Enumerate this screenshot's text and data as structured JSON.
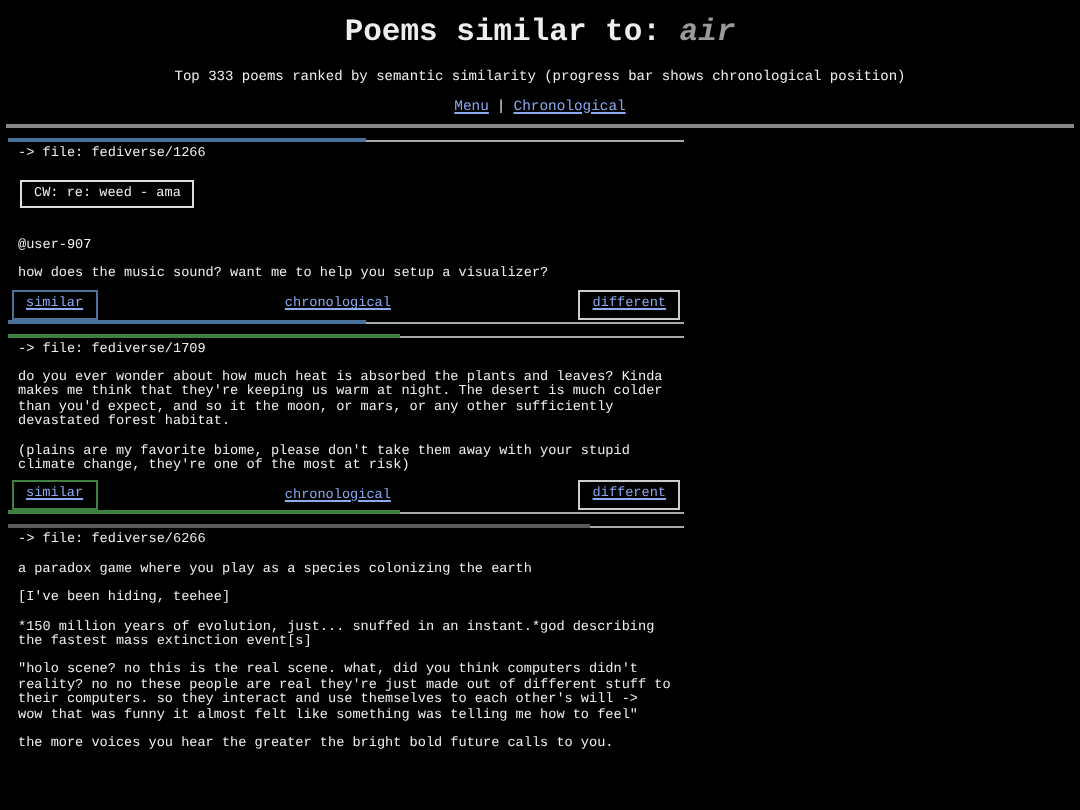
{
  "header": {
    "title": "Poems similar to:",
    "query": "air",
    "subtitle": "Top 333 poems ranked by semantic similarity (progress bar shows chronological position)",
    "links": [
      "Menu",
      "Chronological"
    ],
    "separator": "|"
  },
  "poems": [
    {
      "file": "-> file: fediverse/1266",
      "level": 0.53,
      "color": "#4a7199",
      "cw": "CW: re: weed - ama",
      "paragraphs": [
        "@user-907",
        "how does the music sound? want me to help you setup a visualizer?"
      ],
      "actions": [
        "similar",
        "chronological",
        "different"
      ]
    },
    {
      "file": "-> file: fediverse/1709",
      "level": 0.58,
      "color": "#3f7f3f",
      "paragraphs": [
        "do you ever wonder about how much heat is absorbed the plants and leaves? Kinda\nmakes me think that they're keeping us warm at night. The desert is much colder\nthan you'd expect, and so it the moon, or mars, or any other sufficiently\ndevastated forest habitat.",
        "(plains are my favorite biome, please don't take them away with your stupid\nclimate change, they're one of the most at risk)"
      ],
      "actions": [
        "similar",
        "chronological",
        "different"
      ]
    },
    {
      "file": "-> file: fediverse/6266",
      "level": 0.86,
      "color": "#5a5a5a",
      "paragraphs": [
        "a paradox game where you play as a species colonizing the earth",
        "[I've been hiding, teehee]",
        "*150 million years of evolution, just... snuffed in an instant.*god describing\nthe fastest mass extinction event[s]",
        "\"holo scene? no this is the real scene. what, did you think computers didn't\nreality? no no these people are real they're just made out of different stuff to\ntheir computers. so they interact and use themselves to each other's will ->\nwow that was funny it almost felt like something was telling me how to feel\"",
        "the more voices you hear the greater the bright bold future calls to you."
      ]
    }
  ]
}
